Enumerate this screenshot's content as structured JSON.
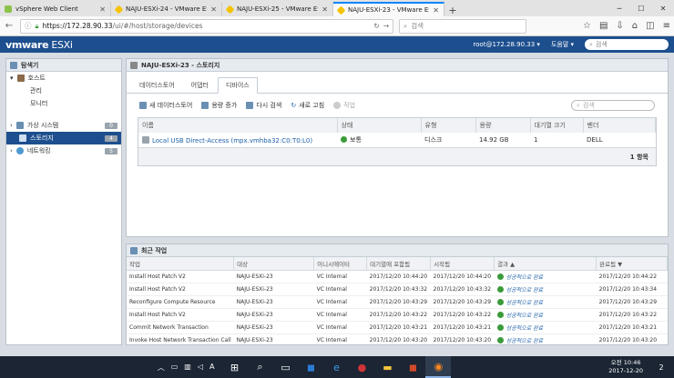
{
  "browser": {
    "tabs": [
      {
        "title": "vSphere Web Client",
        "active": false
      },
      {
        "title": "NAJU-ESXi-24 - VMware ESXi",
        "active": false
      },
      {
        "title": "NAJU-ESXi-25 - VMware ESXi",
        "active": false
      },
      {
        "title": "NAJU-ESXi-23 - VMware ESXi",
        "active": true
      }
    ],
    "url_host": "https://172.28.90.33",
    "url_path": "/ui/#/host/storage/devices",
    "search_placeholder": "검색"
  },
  "esxi": {
    "logo_vm": "vmware",
    "logo_esxi": "ESXi",
    "user": "root@172.28.90.33 ▾",
    "help": "도움말 ▾",
    "search_placeholder": "검색"
  },
  "navigator": {
    "title": "탐색기",
    "host_label": "호스트",
    "host_children": [
      "관리",
      "모니터"
    ],
    "items": [
      {
        "label": "가상 시스템",
        "count": "0",
        "selected": false
      },
      {
        "label": "스토리지",
        "count": "4",
        "selected": true
      },
      {
        "label": "네트워킹",
        "count": "5",
        "selected": false
      }
    ]
  },
  "main": {
    "title": "NAJU-ESXi-23 - 스토리지",
    "tabs": [
      "데이터스토어",
      "어댑터",
      "디바이스"
    ],
    "toolbar": [
      "새 데이터스토어",
      "용량 증가",
      "다시 검색",
      "새로 고침",
      "작업"
    ],
    "filter_placeholder": "검색",
    "columns": [
      "이름",
      "상태",
      "유형",
      "용량",
      "대기열 크기",
      "벤더"
    ],
    "rows": [
      {
        "name": "Local USB Direct-Access (mpx.vmhba32:C0:T0:L0)",
        "status": "보통",
        "type": "디스크",
        "capacity": "14.92 GB",
        "queue": "1",
        "vendor": "DELL"
      }
    ],
    "count": "1 항목"
  },
  "tasks": {
    "title": "최근 작업",
    "columns": [
      "작업",
      "대상",
      "이니시에이터",
      "대기열에 포함됨",
      "시작됨",
      "결과 ▲",
      "완료됨 ▼"
    ],
    "rows": [
      {
        "task": "Install Host Patch V2",
        "target": "NAJU-ESXi-23",
        "init": "VC Internal",
        "queued": "2017/12/20 10:44:20",
        "started": "2017/12/20 10:44:20",
        "result": "성공적으로 완료",
        "done": "2017/12/20 10:44:22"
      },
      {
        "task": "Install Host Patch V2",
        "target": "NAJU-ESXi-23",
        "init": "VC Internal",
        "queued": "2017/12/20 10:43:32",
        "started": "2017/12/20 10:43:32",
        "result": "성공적으로 완료",
        "done": "2017/12/20 10:43:34"
      },
      {
        "task": "Reconfigure Compute Resource",
        "target": "NAJU-ESXi-23",
        "init": "VC Internal",
        "queued": "2017/12/20 10:43:29",
        "started": "2017/12/20 10:43:29",
        "result": "성공적으로 완료",
        "done": "2017/12/20 10:43:29"
      },
      {
        "task": "Install Host Patch V2",
        "target": "NAJU-ESXi-23",
        "init": "VC Internal",
        "queued": "2017/12/20 10:43:22",
        "started": "2017/12/20 10:43:22",
        "result": "성공적으로 완료",
        "done": "2017/12/20 10:43:22"
      },
      {
        "task": "Commit Network Transaction",
        "target": "NAJU-ESXi-23",
        "init": "VC Internal",
        "queued": "2017/12/20 10:43:21",
        "started": "2017/12/20 10:43:21",
        "result": "성공적으로 완료",
        "done": "2017/12/20 10:43:21"
      },
      {
        "task": "Invoke Host Network Transaction Call",
        "target": "NAJU-ESXi-23",
        "init": "VC Internal",
        "queued": "2017/12/20 10:43:20",
        "started": "2017/12/20 10:43:20",
        "result": "성공적으로 완료",
        "done": "2017/12/20 10:43:20"
      }
    ]
  },
  "taskbar": {
    "time": "오전 10:46",
    "date": "2017-12-20",
    "ime": "A",
    "notif": "2"
  }
}
